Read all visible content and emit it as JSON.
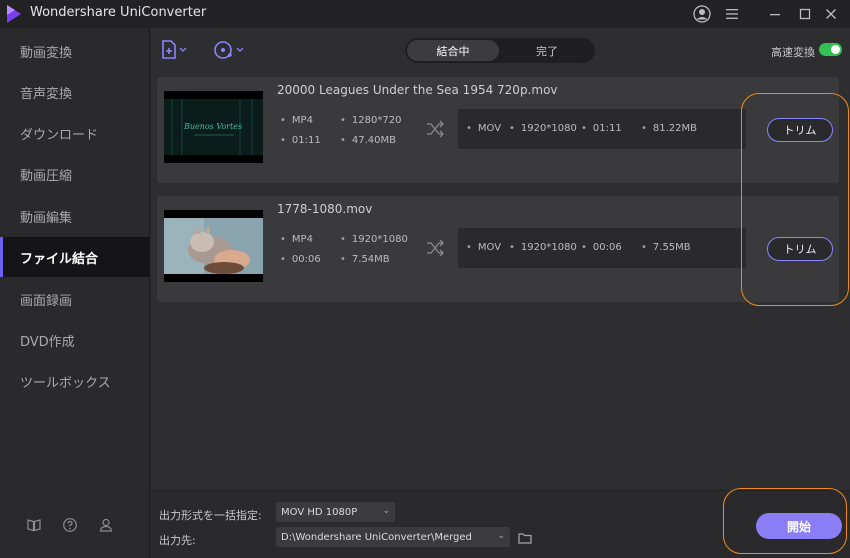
{
  "window": {
    "title": "Wondershare UniConverter",
    "colors": {
      "accent": "#8b84ff",
      "toggle_on": "#33c154",
      "highlight": "#ef8c1b",
      "start": "#8b7df4"
    }
  },
  "sidebar": {
    "items": [
      {
        "label": "動画変換"
      },
      {
        "label": "音声変換"
      },
      {
        "label": "ダウンロード"
      },
      {
        "label": "動画圧縮"
      },
      {
        "label": "動画編集"
      },
      {
        "label": "ファイル結合",
        "active": true
      },
      {
        "label": "画面録画"
      },
      {
        "label": "DVD作成"
      },
      {
        "label": "ツールボックス"
      }
    ],
    "footer_icons": [
      "book-icon",
      "help-icon",
      "account-icon"
    ]
  },
  "toolbar": {
    "tabs": [
      {
        "label": "結合中",
        "selected": true
      },
      {
        "label": "完了"
      }
    ],
    "speed_label": "高速変換",
    "speed_on": true
  },
  "files": [
    {
      "name": "20000 Leagues Under the Sea 1954 720p.mov",
      "src": {
        "format": "MP4",
        "resolution": "1280*720",
        "duration": "01:11",
        "size": "47.40MB"
      },
      "out": {
        "format": "MOV",
        "resolution": "1920*1080",
        "duration": "01:11",
        "size": "81.22MB"
      },
      "thumb_text": "Buenos Vortes",
      "trim_label": "トリム"
    },
    {
      "name": "1778-1080.mov",
      "src": {
        "format": "MP4",
        "resolution": "1920*1080",
        "duration": "00:06",
        "size": "7.54MB"
      },
      "out": {
        "format": "MOV",
        "resolution": "1920*1080",
        "duration": "00:06",
        "size": "7.55MB"
      },
      "trim_label": "トリム"
    }
  ],
  "bottom": {
    "format_label": "出力形式を一括指定:",
    "format_value": "MOV HD 1080P",
    "dest_label": "出力先:",
    "dest_value": "D:\\Wondershare UniConverter\\Merged",
    "start_label": "開始"
  }
}
